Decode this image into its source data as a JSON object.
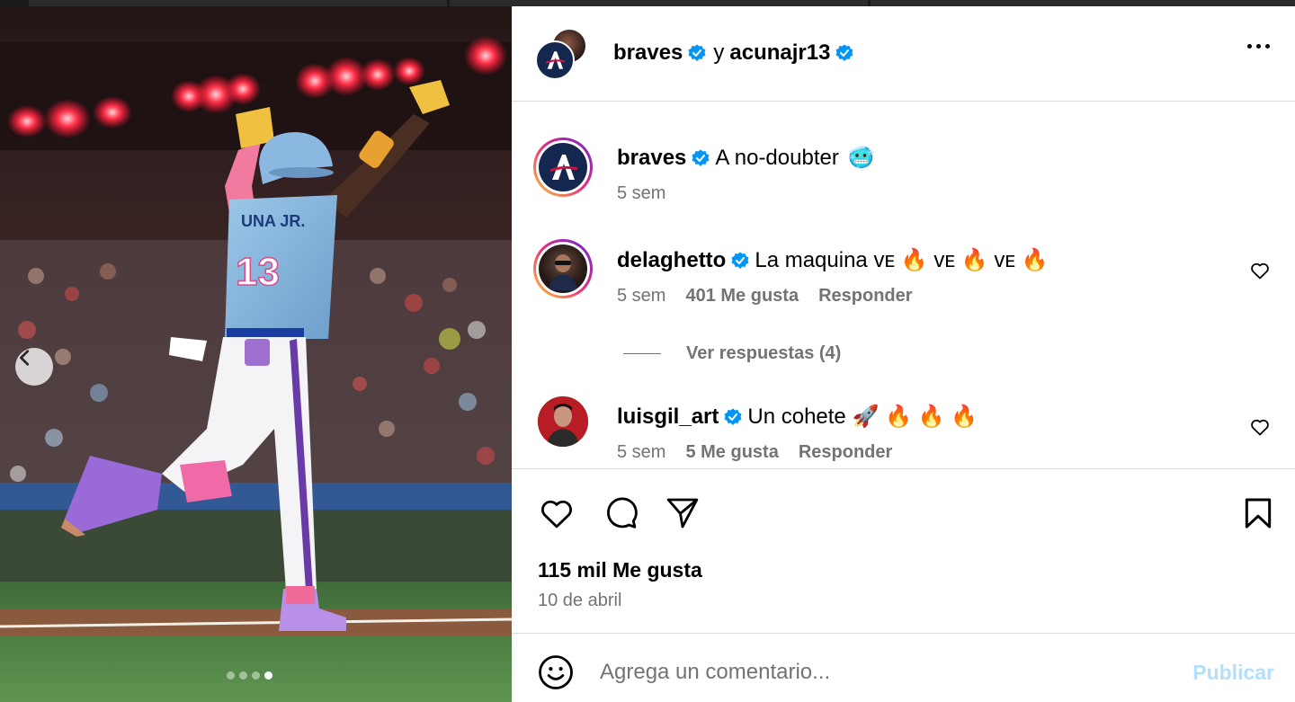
{
  "post": {
    "authors": [
      {
        "username": "braves",
        "verified": true
      },
      {
        "username": "acunajr13",
        "verified": true
      }
    ],
    "conjunction": "y",
    "more_icon": "more-horizontal-icon"
  },
  "carousel": {
    "prev_icon": "chevron-left-icon",
    "total_slides": 4,
    "current_slide": 4
  },
  "comments": [
    {
      "username": "braves",
      "verified": true,
      "text": "A no-doubter",
      "emoji": "🥶",
      "time": "5 sem",
      "likes": "",
      "reply_label": ""
    },
    {
      "username": "delaghetto",
      "verified": true,
      "text": "La maquina ᴠᴇ 🔥 ᴠᴇ 🔥 ᴠᴇ 🔥",
      "time": "5 sem",
      "likes": "401 Me gusta",
      "reply_label": "Responder"
    },
    {
      "username": "luisgil_art",
      "verified": true,
      "text": "Un cohete 🚀 🔥 🔥 🔥",
      "time": "5 sem",
      "likes": "5 Me gusta",
      "reply_label": "Responder"
    }
  ],
  "view_replies": "Ver respuestas (4)",
  "actions": {
    "like_icon": "heart-icon",
    "comment_icon": "comment-icon",
    "share_icon": "share-icon",
    "save_icon": "bookmark-icon"
  },
  "likes_count": "115 mil Me gusta",
  "post_date": "10 de abril",
  "comment_box": {
    "placeholder": "Agrega un comentario...",
    "publish_label": "Publicar",
    "emoji_icon": "smiley-icon"
  },
  "colors": {
    "verified_blue": "#0095f6",
    "publish_disabled": "#b2dffc",
    "secondary_text": "#737373",
    "braves_navy": "#13274f"
  }
}
